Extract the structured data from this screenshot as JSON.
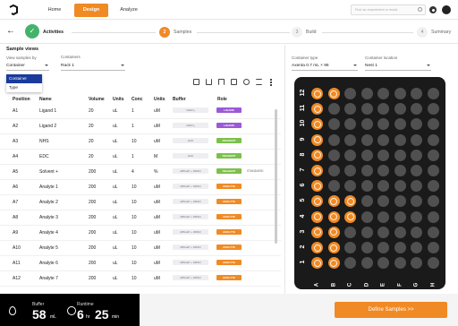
{
  "nav": {
    "home": "Home",
    "design": "Design",
    "analyze": "Analyze",
    "search_placeholder": "Find an experiment or result"
  },
  "stepper": {
    "steps": [
      {
        "num": "✓",
        "label": "Activities",
        "state": "done"
      },
      {
        "num": "2",
        "label": "Samples",
        "state": "active"
      },
      {
        "num": "3",
        "label": "Build",
        "state": "idle"
      },
      {
        "num": "4",
        "label": "Summary",
        "state": "idle"
      }
    ]
  },
  "left": {
    "title": "Sample views",
    "view_by_label": "View samples by",
    "view_by_value": "Container",
    "containers_label": "Containers",
    "containers_value": "Rack 1",
    "dropdown_options": [
      "Container",
      "Type"
    ],
    "columns": [
      "Position",
      "Name",
      "Volume",
      "Units",
      "Conc",
      "Units",
      "Buffer",
      "Role"
    ],
    "rows": [
      {
        "pos": "A1",
        "name": "Ligand 1",
        "vol": "20",
        "vunit": "uL",
        "conc": "1",
        "cunit": "uM",
        "buffer": "NaNO₃",
        "role": "LIGAND",
        "rolecolor": "#9b59d6",
        "extra": ""
      },
      {
        "pos": "A2",
        "name": "Ligand 2",
        "vol": "20",
        "vunit": "uL",
        "conc": "1",
        "cunit": "uM",
        "buffer": "NaNO₃",
        "role": "LIGAND",
        "rolecolor": "#9b59d6",
        "extra": ""
      },
      {
        "pos": "A3",
        "name": "NHS",
        "vol": "20",
        "vunit": "uL",
        "conc": "10",
        "cunit": "uM",
        "buffer": "H2O",
        "role": "REAGENT",
        "rolecolor": "#7cc04b",
        "extra": ""
      },
      {
        "pos": "A4",
        "name": "EDC",
        "vol": "20",
        "vunit": "uL",
        "conc": "1",
        "cunit": "M",
        "buffer": "H2O",
        "role": "REAGENT",
        "rolecolor": "#7cc04b",
        "extra": ""
      },
      {
        "pos": "A5",
        "name": "Solvent +",
        "vol": "200",
        "vunit": "uL",
        "conc": "4",
        "cunit": "%",
        "buffer": "HBS-EP + DMSO",
        "role": "REAGENT",
        "rolecolor": "#7cc04b",
        "extra": "STANDARD"
      },
      {
        "pos": "A6",
        "name": "Analyte 1",
        "vol": "200",
        "vunit": "uL",
        "conc": "10",
        "cunit": "uM",
        "buffer": "HBS-EP + DMSO",
        "role": "ANALYTE",
        "rolecolor": "#f08a24",
        "extra": ""
      },
      {
        "pos": "A7",
        "name": "Analyte 2",
        "vol": "200",
        "vunit": "uL",
        "conc": "10",
        "cunit": "uM",
        "buffer": "HBS-EP + DMSO",
        "role": "ANALYTE",
        "rolecolor": "#f08a24",
        "extra": ""
      },
      {
        "pos": "A8",
        "name": "Analyte 3",
        "vol": "200",
        "vunit": "uL",
        "conc": "10",
        "cunit": "uM",
        "buffer": "HBS-EP + DMSO",
        "role": "ANALYTE",
        "rolecolor": "#f08a24",
        "extra": ""
      },
      {
        "pos": "A9",
        "name": "Analyte 4",
        "vol": "200",
        "vunit": "uL",
        "conc": "10",
        "cunit": "uM",
        "buffer": "HBS-EP + DMSO",
        "role": "ANALYTE",
        "rolecolor": "#f08a24",
        "extra": ""
      },
      {
        "pos": "A10",
        "name": "Analyte 5",
        "vol": "200",
        "vunit": "uL",
        "conc": "10",
        "cunit": "uM",
        "buffer": "HBS-EP + DMSO",
        "role": "ANALYTE",
        "rolecolor": "#f08a24",
        "extra": ""
      },
      {
        "pos": "A11",
        "name": "Analyte 6",
        "vol": "200",
        "vunit": "uL",
        "conc": "10",
        "cunit": "uM",
        "buffer": "HBS-EP + DMSO",
        "role": "ANALYTE",
        "rolecolor": "#f08a24",
        "extra": ""
      },
      {
        "pos": "A12",
        "name": "Analyte 7",
        "vol": "200",
        "vunit": "uL",
        "conc": "10",
        "cunit": "uM",
        "buffer": "HBS-EP + DMSO",
        "role": "ANALYTE",
        "rolecolor": "#f08a24",
        "extra": ""
      }
    ]
  },
  "right": {
    "type_label": "Container type",
    "type_value": "Axenta 0.7 mL × 96",
    "location_label": "Container location",
    "location_value": "Nest 1",
    "row_labels": [
      "12",
      "11",
      "10",
      "9",
      "8",
      "7",
      "6",
      "5",
      "4",
      "3",
      "2",
      "1"
    ],
    "col_labels": [
      "A",
      "B",
      "C",
      "D",
      "E",
      "F",
      "G",
      "H"
    ],
    "filled_wells": [
      [
        1,
        1,
        0,
        0,
        0,
        0,
        0,
        0
      ],
      [
        1,
        0,
        0,
        0,
        0,
        0,
        0,
        0
      ],
      [
        1,
        0,
        0,
        0,
        0,
        0,
        0,
        0
      ],
      [
        1,
        0,
        0,
        0,
        0,
        0,
        0,
        0
      ],
      [
        1,
        0,
        0,
        0,
        0,
        0,
        0,
        0
      ],
      [
        1,
        0,
        0,
        0,
        0,
        0,
        0,
        0
      ],
      [
        1,
        0,
        0,
        0,
        0,
        0,
        0,
        0
      ],
      [
        1,
        1,
        1,
        0,
        0,
        0,
        0,
        0
      ],
      [
        1,
        1,
        1,
        0,
        0,
        0,
        0,
        0
      ],
      [
        1,
        1,
        0,
        0,
        0,
        0,
        0,
        0
      ],
      [
        1,
        1,
        0,
        0,
        0,
        0,
        0,
        0
      ],
      [
        1,
        1,
        0,
        0,
        0,
        0,
        0,
        0
      ]
    ],
    "accent": "#f08a24"
  },
  "footer": {
    "buffer_label": "Buffer",
    "buffer_value": "58",
    "buffer_unit": "mL",
    "runtime_label": "Runtime",
    "runtime_h": "6",
    "runtime_h_unit": "hr",
    "runtime_m": "25",
    "runtime_m_unit": "min",
    "define_button": "Define Samples >>"
  }
}
